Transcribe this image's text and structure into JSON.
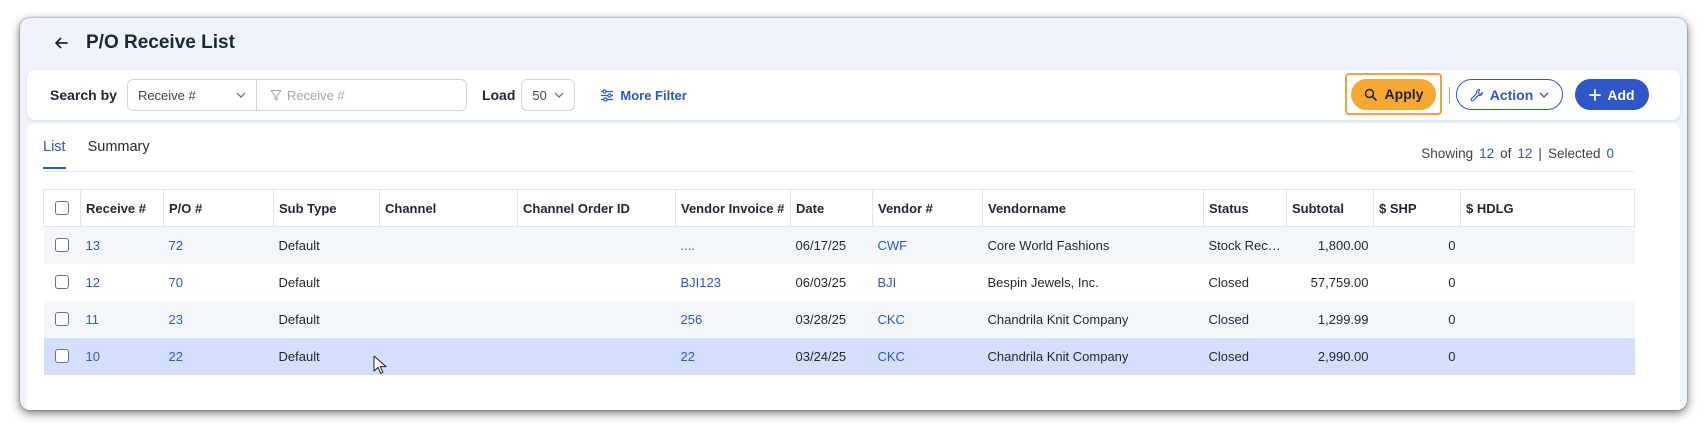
{
  "header": {
    "title": "P/O Receive List"
  },
  "filter": {
    "search_by_label": "Search by",
    "search_field_selected": "Receive #",
    "search_placeholder": "Receive #",
    "load_label": "Load",
    "load_value": "50",
    "more_filter_label": "More Filter",
    "apply_label": "Apply",
    "action_label": "Action",
    "add_label": "Add"
  },
  "tabs": [
    {
      "label": "List"
    },
    {
      "label": "Summary"
    }
  ],
  "summary": {
    "showing_label": "Showing",
    "showing_count": "12",
    "of_label": "of",
    "total_count": "12",
    "divider": "|",
    "selected_label": "Selected",
    "selected_count": "0"
  },
  "table": {
    "columns": [
      "Receive #",
      "P/O #",
      "Sub Type",
      "Channel",
      "Channel Order ID",
      "Vendor Invoice #",
      "Date",
      "Vendor #",
      "Vendorname",
      "Status",
      "Subtotal",
      "$ SHP",
      "$ HDLG"
    ],
    "rows": [
      {
        "receive": "13",
        "po": "72",
        "subtype": "Default",
        "channel": "",
        "channel_order": "",
        "vendor_invoice": "....",
        "date": "06/17/25",
        "vendor": "CWF",
        "vendorname": "Core World Fashions",
        "status": "Stock Recei...",
        "subtotal": "1,800.00",
        "shp": "0",
        "hdlg": ""
      },
      {
        "receive": "12",
        "po": "70",
        "subtype": "Default",
        "channel": "",
        "channel_order": "",
        "vendor_invoice": "BJI123",
        "date": "06/03/25",
        "vendor": "BJI",
        "vendorname": "Bespin Jewels, Inc.",
        "status": "Closed",
        "subtotal": "57,759.00",
        "shp": "0",
        "hdlg": ""
      },
      {
        "receive": "11",
        "po": "23",
        "subtype": "Default",
        "channel": "",
        "channel_order": "",
        "vendor_invoice": "256",
        "date": "03/28/25",
        "vendor": "CKC",
        "vendorname": "Chandrila Knit Company",
        "status": "Closed",
        "subtotal": "1,299.99",
        "shp": "0",
        "hdlg": ""
      },
      {
        "receive": "10",
        "po": "22",
        "subtype": "Default",
        "channel": "",
        "channel_order": "",
        "vendor_invoice": "22",
        "date": "03/24/25",
        "vendor": "CKC",
        "vendorname": "Chandrila Knit Company",
        "status": "Closed",
        "subtotal": "2,990.00",
        "shp": "0",
        "hdlg": ""
      }
    ]
  },
  "colors": {
    "accent": "#2f57c7",
    "apply": "#f7a833",
    "selected_row": "#d4dffb"
  }
}
